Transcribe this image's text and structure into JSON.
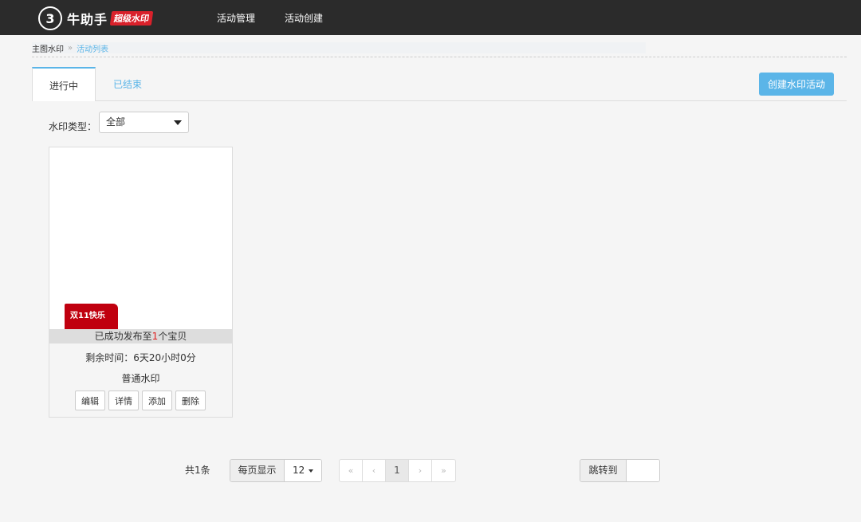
{
  "header": {
    "logo_glyph": "3",
    "brand": "牛助手",
    "badge": "超级水印",
    "nav": [
      "活动管理",
      "活动创建"
    ]
  },
  "breadcrumb": {
    "home": "主图水印",
    "separator": "»",
    "current": "活动列表"
  },
  "tabs": {
    "active": "进行中",
    "ended": "已结束"
  },
  "create_button": "创建水印活动",
  "filter": {
    "label": "水印类型：",
    "selected": "全部"
  },
  "card": {
    "watermark_text": "双11快乐",
    "published_prefix": "已成功发布至",
    "published_count": "1",
    "published_suffix": "个宝贝",
    "remaining": "剩余时间：6天20小时0分",
    "type": "普通水印",
    "actions": {
      "edit": "编辑",
      "detail": "详情",
      "add": "添加",
      "delete": "删除"
    }
  },
  "pagination": {
    "total": "共1条",
    "per_page_label": "每页显示",
    "per_page_value": "12",
    "first": "«",
    "prev": "‹",
    "current_page": "1",
    "next": "›",
    "last": "»",
    "jump_label": "跳转到",
    "jump_value": ""
  },
  "colors": {
    "topbar": "#2b2b2b",
    "accent": "#5bb5e8",
    "badge": "#d9212b",
    "watermark_tag": "#c0000f"
  }
}
